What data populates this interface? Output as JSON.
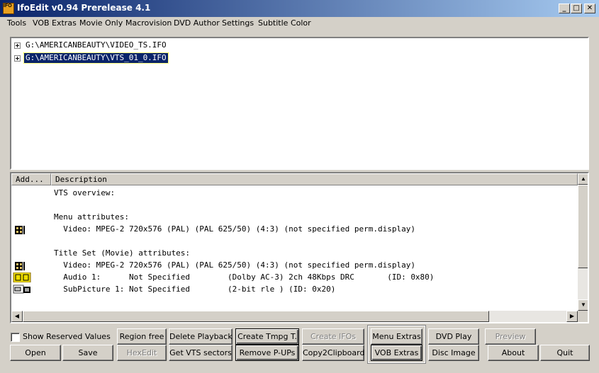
{
  "window": {
    "title": "IfoEdit v0.94 Prerelease 4.1",
    "icon_label": "IFO",
    "controls": {
      "minimize": "_",
      "maximize": "□",
      "close": "✕"
    }
  },
  "menu": [
    "Tools",
    "VOB Extras",
    "Movie Only",
    "Macrovision",
    "DVD Author",
    "Settings",
    "Subtitle Color"
  ],
  "tree": {
    "items": [
      {
        "label": "G:\\AMERICANBEAUTY\\VIDEO_TS.IFO",
        "selected": false
      },
      {
        "label": "G:\\AMERICANBEAUTY\\VTS_01_0.IFO",
        "selected": true
      }
    ]
  },
  "list": {
    "columns": [
      "Add...",
      "Description"
    ],
    "rows": [
      {
        "icon": "",
        "text": "VTS overview:"
      },
      {
        "icon": "",
        "text": ""
      },
      {
        "icon": "",
        "text": "Menu attributes:"
      },
      {
        "icon": "film-icon",
        "text": "  Video: MPEG-2 720x576 (PAL) (PAL 625/50) (4:3) (not specified perm.display)"
      },
      {
        "icon": "",
        "text": ""
      },
      {
        "icon": "",
        "text": "Title Set (Movie) attributes:"
      },
      {
        "icon": "film-icon",
        "text": "  Video: MPEG-2 720x576 (PAL) (PAL 625/50) (4:3) (not specified perm.display)"
      },
      {
        "icon": "audio-icon",
        "text": "  Audio 1:      Not Specified        (Dolby AC-3) 2ch 48Kbps DRC       (ID: 0x80)"
      },
      {
        "icon": "subpicture-icon",
        "text": "  SubPicture 1: Not Specified        (2-bit rle ) (ID: 0x20)"
      }
    ]
  },
  "controls": {
    "show_reserved": {
      "label": "Show Reserved Values",
      "checked": false
    },
    "buttons": {
      "open": "Open",
      "save": "Save",
      "region_free": "Region free",
      "hexedit": "HexEdit",
      "delete_playback": "Delete Playback",
      "get_vts_sectors": "Get VTS sectors",
      "create_tmpg": "Create Tmpg T.",
      "remove_pups": "Remove P-UPs",
      "create_ifos": "Create IFOs",
      "copy2clipboard": "Copy2Clipboard",
      "menu_extras": "Menu Extras",
      "vob_extras": "VOB Extras",
      "dvd_play": "DVD Play",
      "disc_image": "Disc Image",
      "preview": "Preview",
      "about": "About",
      "quit": "Quit"
    }
  }
}
